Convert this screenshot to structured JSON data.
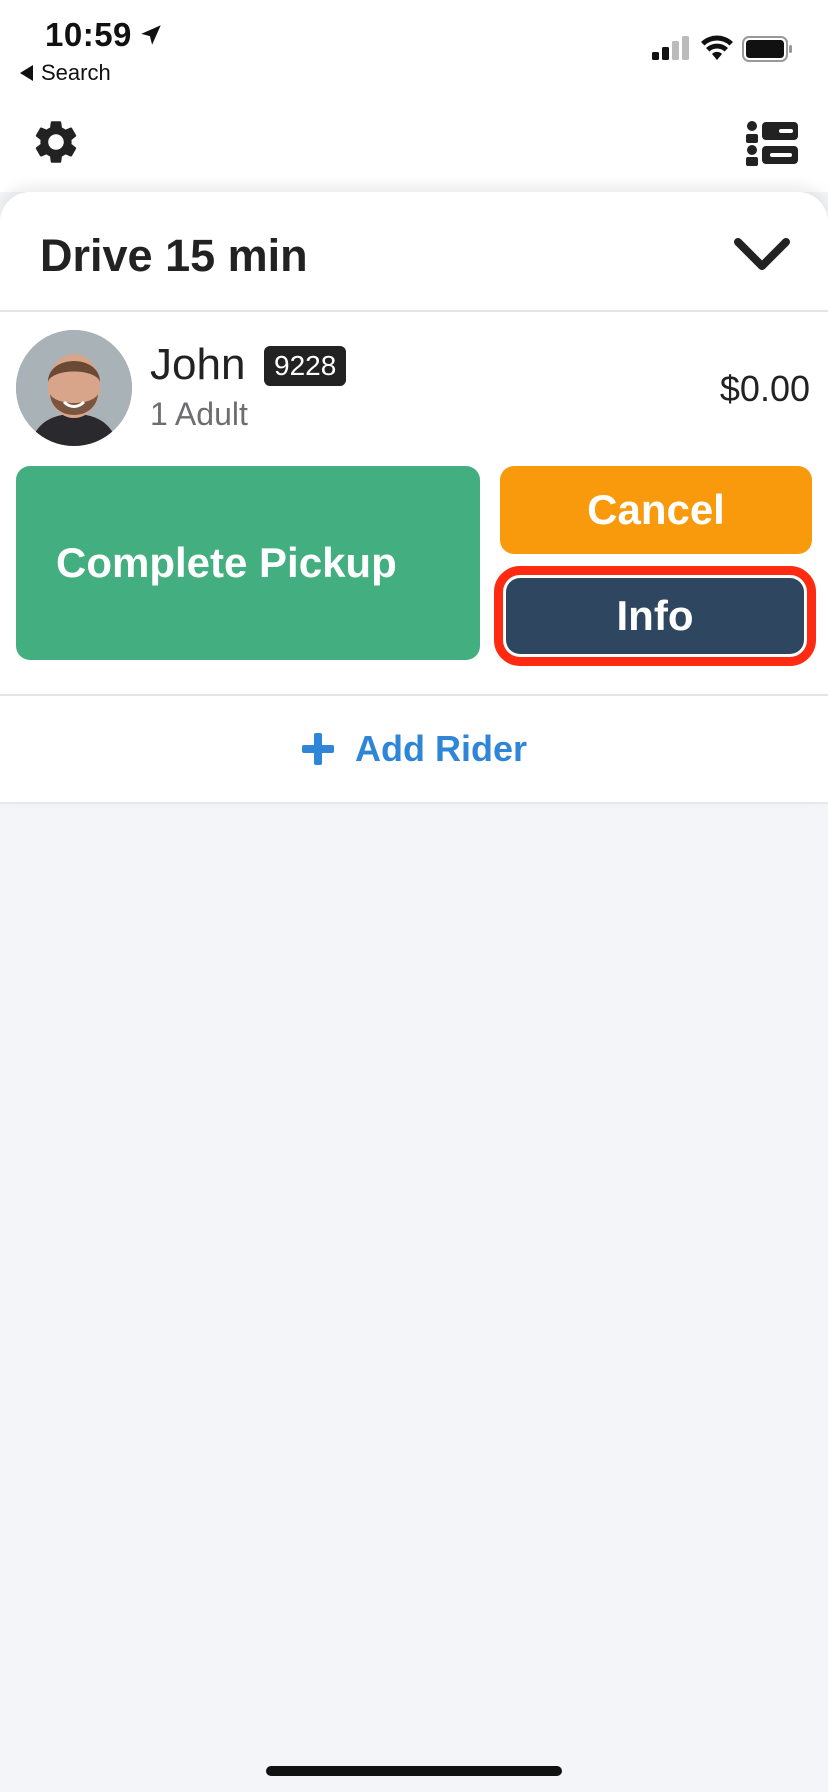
{
  "status_bar": {
    "time": "10:59",
    "back_label": "Search"
  },
  "card": {
    "title": "Drive 15 min",
    "rider": {
      "name": "John",
      "badge": "9228",
      "subtitle": "1 Adult",
      "price": "$0.00"
    },
    "buttons": {
      "complete": "Complete Pickup",
      "cancel": "Cancel",
      "info": "Info"
    },
    "add_rider": "Add Rider"
  },
  "colors": {
    "complete": "#43ae80",
    "cancel": "#f89a0c",
    "info": "#2e4660",
    "highlight": "#ff2a12",
    "link": "#2f86d6"
  },
  "icons": [
    "location-arrow-icon",
    "signal-icon",
    "wifi-icon",
    "battery-icon",
    "gear-icon",
    "list-icon",
    "chevron-down-icon",
    "plus-icon"
  ]
}
